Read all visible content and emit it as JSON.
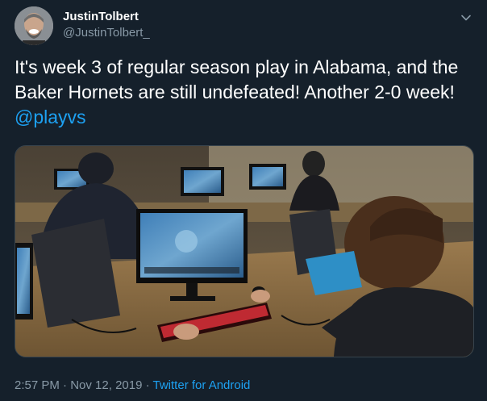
{
  "author": {
    "display_name": "JustinTolbert",
    "handle": "@JustinTolbert_"
  },
  "tweet": {
    "text": "It's week 3 of regular season play in Alabama, and the Baker Hornets are still undefeated! Another 2-0 week!",
    "mention": "@playvs",
    "time": "2:57 PM",
    "separator1": " · ",
    "date": "Nov 12, 2019",
    "separator2": " · ",
    "source": "Twitter for Android"
  },
  "icons": {
    "menu": "chevron-down-icon"
  },
  "colors": {
    "background": "#15202b",
    "accent": "#1da1f2",
    "secondary_text": "#8899a6",
    "border": "#38444d"
  }
}
